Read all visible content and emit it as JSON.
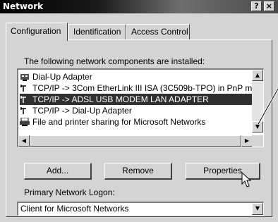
{
  "window": {
    "title": "Network"
  },
  "titlebar_buttons": {
    "help": "?",
    "close": "×"
  },
  "tabs": [
    {
      "label": "Configuration",
      "active": true
    },
    {
      "label": "Identification",
      "active": false
    },
    {
      "label": "Access Control",
      "active": false
    }
  ],
  "components": {
    "label": "The following network components are installed:",
    "items": [
      {
        "icon": "dialup-adapter-icon",
        "label": "Dial-Up Adapter",
        "selected": false
      },
      {
        "icon": "network-protocol-icon",
        "label": "TCP/IP -> 3Com EtherLink III ISA (3C509b-TPO) in PnP m",
        "selected": false
      },
      {
        "icon": "network-protocol-icon",
        "label": "TCP/IP -> ADSL USB MODEM LAN ADAPTER",
        "selected": true
      },
      {
        "icon": "network-protocol-icon",
        "label": "TCP/IP -> Dial-Up Adapter",
        "selected": false
      },
      {
        "icon": "file-printer-sharing-icon",
        "label": "File and printer sharing for Microsoft Networks",
        "selected": false
      }
    ]
  },
  "buttons": {
    "add": "Add...",
    "remove": "Remove",
    "properties": "Properties"
  },
  "logon": {
    "label": "Primary Network Logon:",
    "value": "Client for Microsoft Networks"
  },
  "colors": {
    "selection": "#303030",
    "face": "#d4d4d4"
  }
}
